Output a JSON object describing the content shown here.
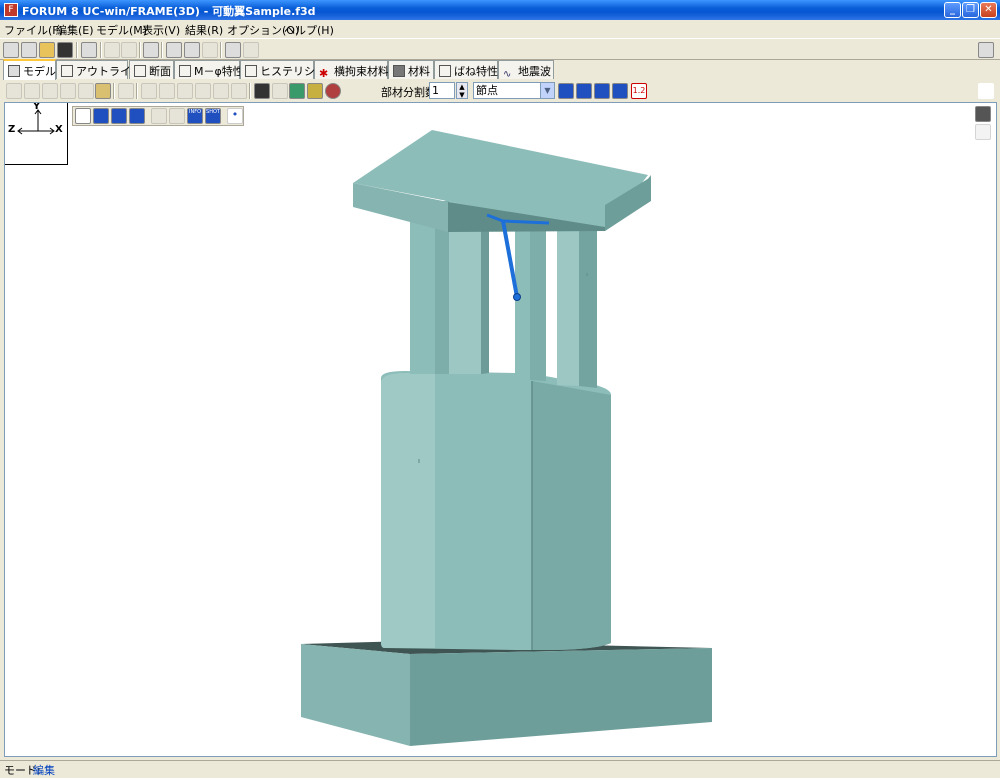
{
  "window": {
    "title": "FORUM 8  UC-win/FRAME(3D) - 可動翼Sample.f3d",
    "min_glyph": "_",
    "max_glyph": "❐",
    "close_glyph": "✕"
  },
  "menu": [
    {
      "id": "file",
      "label": "ファイル(F)"
    },
    {
      "id": "edit",
      "label": "編集(E)"
    },
    {
      "id": "model",
      "label": "モデル(M)"
    },
    {
      "id": "view",
      "label": "表示(V)"
    },
    {
      "id": "result",
      "label": "結果(R)"
    },
    {
      "id": "option",
      "label": "オプション(O)"
    },
    {
      "id": "help",
      "label": "ヘルプ(H)"
    }
  ],
  "tabs": [
    {
      "id": "model",
      "label": "モデル",
      "icon": "model-icon",
      "active": true
    },
    {
      "id": "outline",
      "label": "アウトライン",
      "icon": "outline-icon"
    },
    {
      "id": "section",
      "label": "断面",
      "icon": "section-icon"
    },
    {
      "id": "m-phi",
      "label": "M－φ特性",
      "icon": "m-phi-icon"
    },
    {
      "id": "hysteresis",
      "label": "ヒステリシス",
      "icon": "hysteresis-icon"
    },
    {
      "id": "confined",
      "label": "横拘束材料",
      "icon": "confined-icon"
    },
    {
      "id": "material",
      "label": "材料",
      "icon": "material-icon"
    },
    {
      "id": "spring",
      "label": "ばね特性",
      "icon": "spring-icon"
    },
    {
      "id": "earthquake",
      "label": "地震波",
      "icon": "earthquake-icon"
    }
  ],
  "toolbar2": {
    "division_label": "部材分割数",
    "division_value": "1",
    "selection_mode": "節点",
    "spin_up": "▲",
    "spin_down": "▼",
    "dropdown_glyph": "▼",
    "scale_label": "1.2"
  },
  "axes": {
    "y": "Y",
    "z": "Z",
    "x": "X"
  },
  "viewtools_info": "INFO",
  "viewtools_shot": "SHOT",
  "statusbar": {
    "mode_label": "モード:",
    "mode_value": "編集"
  },
  "colors": {
    "model_face_light": "#8fbcb9",
    "model_face_mid": "#7aa9a5",
    "model_face_dark": "#5f8c88",
    "member_line": "#1d6fd9"
  }
}
